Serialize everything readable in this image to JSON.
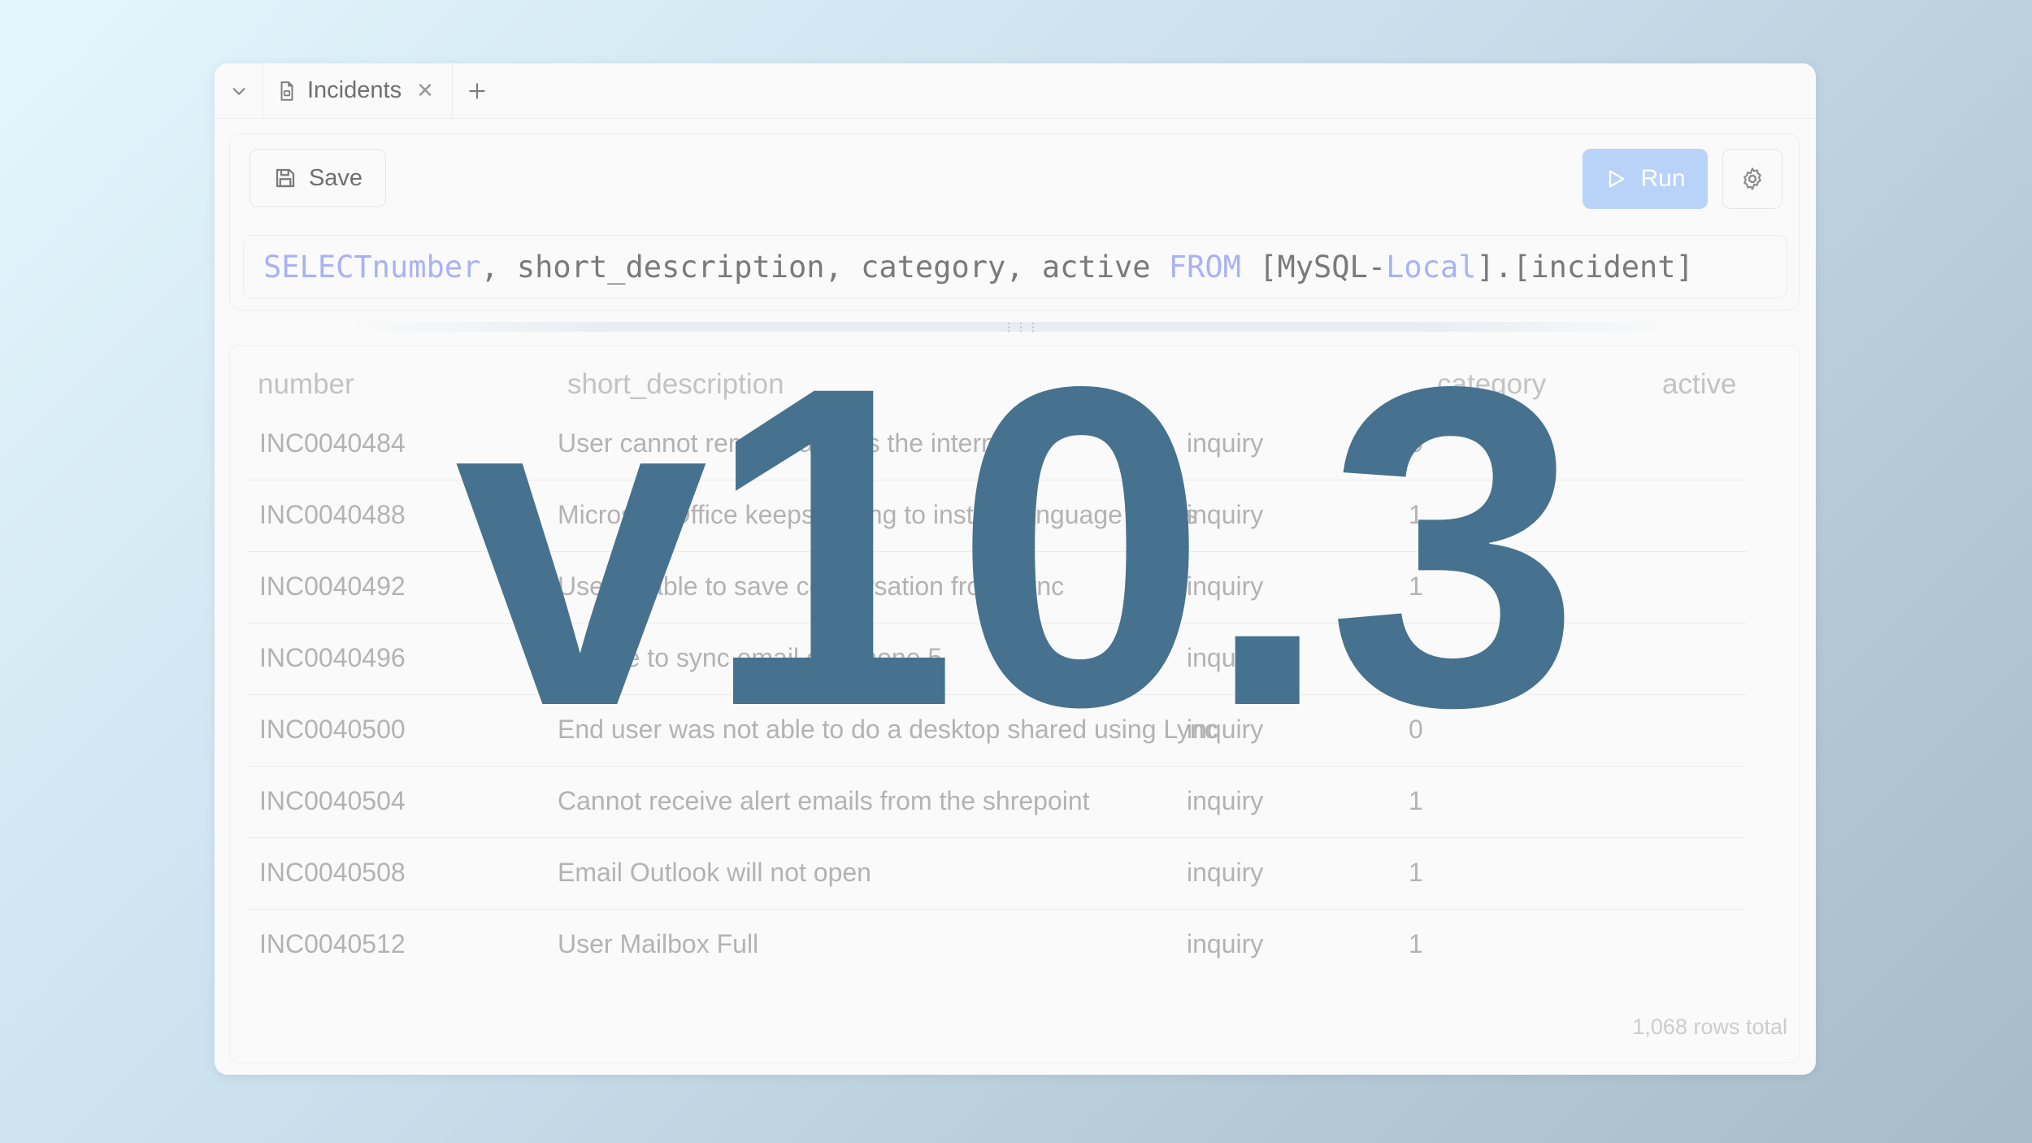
{
  "tabs": [
    {
      "label": "Incidents",
      "icon": "document-icon"
    }
  ],
  "toolbar": {
    "save_label": "Save",
    "run_label": "Run"
  },
  "query": {
    "kw_select": "SELECT",
    "field_number": "number",
    "part_fields": ", short_description, category, active ",
    "kw_from": "FROM",
    "part_src1": " [MySQL-",
    "field_local": "Local",
    "part_src2": "].[incident]"
  },
  "table": {
    "columns": [
      "number",
      "short_description",
      "category",
      "active"
    ],
    "rows": [
      [
        "INC0040484",
        "User cannot remove access the internet",
        "inquiry",
        "0"
      ],
      [
        "INC0040488",
        "Microsoft Office keeps asking to install Language packs",
        "inquiry",
        "1"
      ],
      [
        "INC0040492",
        "User unable to save conversation from Lync",
        "inquiry",
        "1"
      ],
      [
        "INC0040496",
        "Unable to sync email on iphone 5",
        "inquiry",
        "0"
      ],
      [
        "INC0040500",
        "End user was not able to do a desktop shared using Lync",
        "inquiry",
        "0"
      ],
      [
        "INC0040504",
        "Cannot receive alert emails from the shrepoint",
        "inquiry",
        "1"
      ],
      [
        "INC0040508",
        "Email Outlook will not open",
        "inquiry",
        "1"
      ],
      [
        "INC0040512",
        "User Mailbox Full",
        "inquiry",
        "1"
      ]
    ],
    "footer": "1,068 rows total"
  },
  "overlay": {
    "version": "v10.3"
  },
  "colors": {
    "accent_run": "#b8d3f7",
    "keyword": "#a9b2f5",
    "version_text": "#46728f"
  }
}
